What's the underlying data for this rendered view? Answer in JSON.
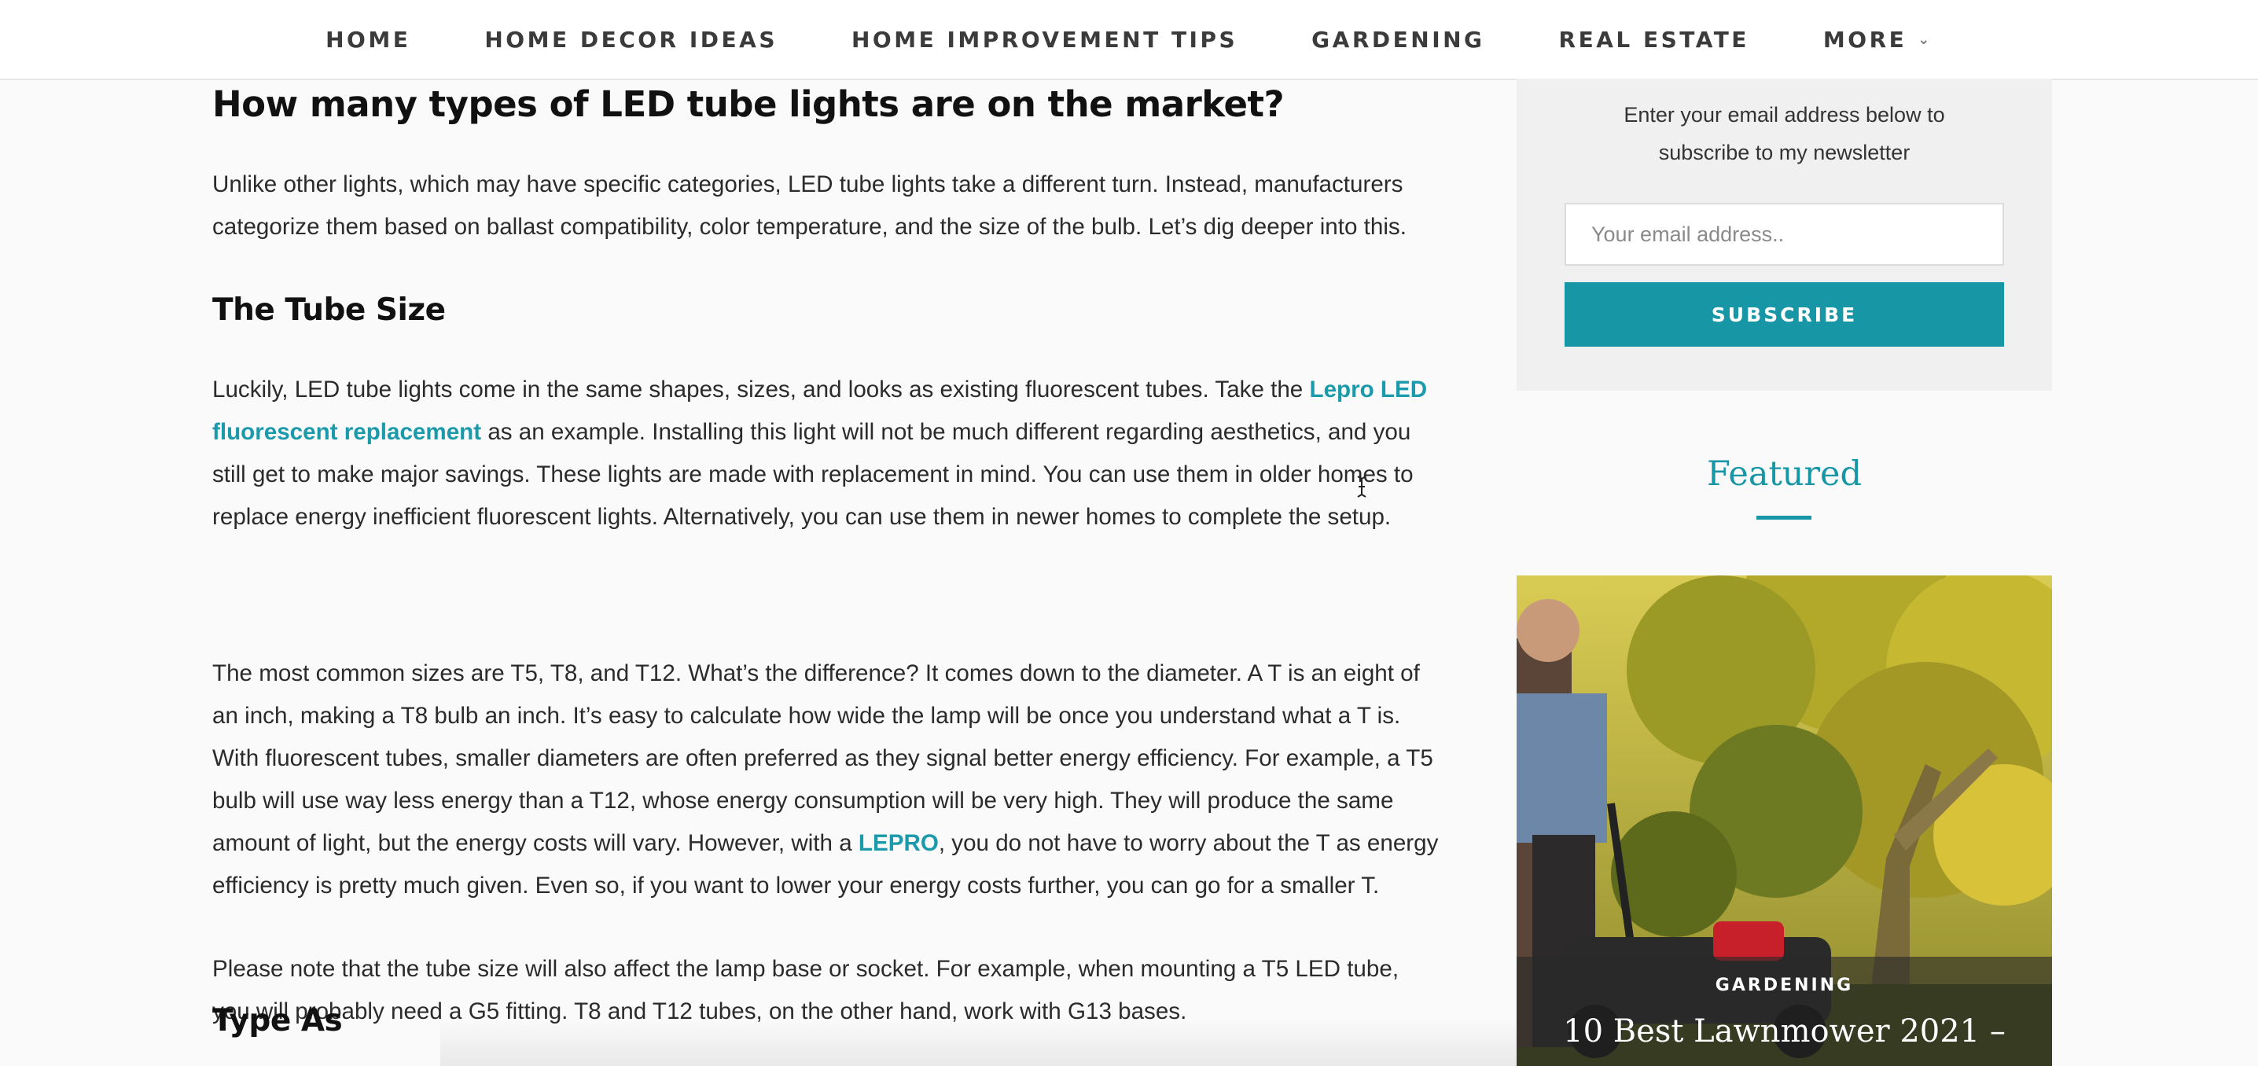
{
  "nav": {
    "items": [
      {
        "label": "HOME"
      },
      {
        "label": "HOME DECOR IDEAS"
      },
      {
        "label": "HOME IMPROVEMENT TIPS"
      },
      {
        "label": "GARDENING"
      },
      {
        "label": "REAL ESTATE"
      },
      {
        "label": "MORE"
      }
    ],
    "more_chevron": "⌄"
  },
  "article": {
    "heading_main": "How many types of LED tube lights are on the market?",
    "intro": "Unlike other lights, which may have specific categories, LED tube lights take a different turn. Instead, manufacturers categorize them based on ballast compatibility, color temperature, and the size of the bulb. Let’s dig deeper into this.",
    "heading_tube_size": "The Tube Size",
    "p1_before": "Luckily, LED tube lights come in the same shapes, sizes, and looks as existing fluorescent tubes. Take the ",
    "p1_link": "Lepro LED fluorescent replacement",
    "p1_after": " as an example. Installing this light will not be much different regarding aesthetics, and you still get to make major savings. These lights are made with replacement in mind. You can use them in older homes to replace energy inefficient fluorescent lights. Alternatively, you can use them in newer homes to complete the setup.",
    "p2_before": "The most common sizes are T5, T8, and T12. What’s the difference? It comes down to the diameter. A T is an eight of an inch, making a T8 bulb an inch. It’s easy to calculate how wide the lamp will be once you understand what a T is. With fluorescent tubes, smaller diameters are often preferred as they signal better energy efficiency. For example, a T5 bulb will use way less energy than a T12, whose energy consumption will be very high. They will produce the same amount of light, but the energy costs will vary. However, with a ",
    "p2_link": "LEPRO",
    "p2_after": ", you do not have to worry about the T as energy efficiency is pretty much given. Even so, if you want to lower your energy costs further, you can go for a smaller T.",
    "p3": "Please note that the tube size will also affect the lamp base or socket. For example, when mounting a T5 LED tube, you will probably need a G5 fitting. T8 and T12 tubes, on the other hand, work with G13 bases.",
    "heading_type_as": "Type As"
  },
  "sidebar": {
    "newsletter_text": "Enter your email address below to subscribe to my newsletter",
    "email_placeholder": "Your email address..",
    "subscribe_label": "SUBSCRIBE",
    "featured_title": "Featured",
    "featured_card": {
      "category": "GARDENING",
      "title": "10 Best Lawnmower 2021 –"
    }
  },
  "colors": {
    "accent": "#1797a6",
    "link": "#1a9aaa",
    "nav_text": "#3b3b3b",
    "background": "#fafafa"
  }
}
